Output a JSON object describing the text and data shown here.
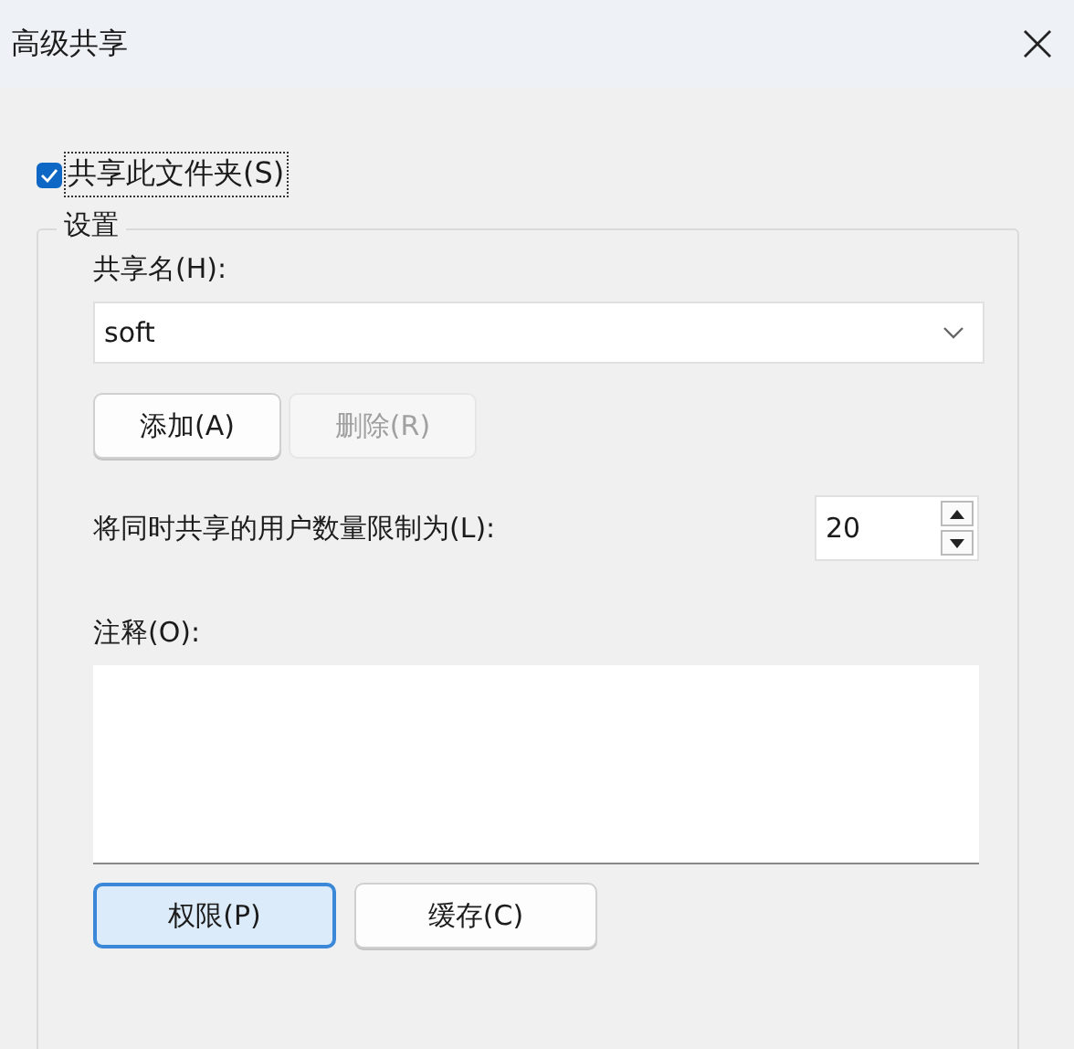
{
  "window": {
    "title": "高级共享"
  },
  "share_checkbox": {
    "label": "共享此文件夹(S)",
    "checked": true
  },
  "settings": {
    "title": "设置",
    "share_name": {
      "label": "共享名(H):",
      "value": "soft"
    },
    "name_buttons": [
      {
        "label": "添加(A)",
        "disabled": false
      },
      {
        "label": "删除(R)",
        "disabled": true
      }
    ],
    "user_limit": {
      "label": "将同时共享的用户数量限制为(L):",
      "value": "20"
    },
    "comment": {
      "label": "注释(O):"
    },
    "bottom_buttons": [
      {
        "label": "权限(P)",
        "default": true
      },
      {
        "label": "缓存(C)",
        "default": false
      }
    ]
  }
}
